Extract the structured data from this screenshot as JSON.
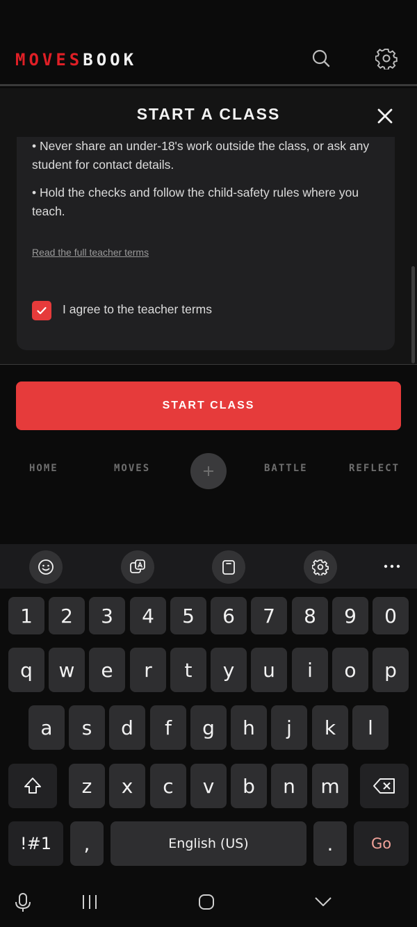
{
  "app": {
    "logo_red": "MOVES",
    "logo_white": "BOOK",
    "header_icons": [
      "search-icon",
      "gear-icon"
    ]
  },
  "sheet": {
    "title": "START A CLASS",
    "close_icon": "close-icon",
    "bullets": [
      "• Never share an under-18's work outside the class, or ask any student for contact details.",
      "• Hold the checks and follow the child-safety rules where you teach."
    ],
    "terms_link": "Read the full teacher terms",
    "agree_label": "I agree to the teacher terms",
    "agree_checked": true
  },
  "cta": {
    "label": "START CLASS"
  },
  "bottom_nav": {
    "items": [
      {
        "label": "HOME"
      },
      {
        "label": "MOVES"
      },
      {
        "label": "BATTLE"
      },
      {
        "label": "REFLECT"
      }
    ],
    "center_icon": "plus-icon"
  },
  "keyboard": {
    "toolbar_icons": [
      "emoji-icon",
      "translate-icon",
      "clipboard-icon",
      "gear-icon",
      "more-icon"
    ],
    "number_row": [
      "1",
      "2",
      "3",
      "4",
      "5",
      "6",
      "7",
      "8",
      "9",
      "0"
    ],
    "row1": [
      "q",
      "w",
      "e",
      "r",
      "t",
      "y",
      "u",
      "i",
      "o",
      "p"
    ],
    "row2": [
      "a",
      "s",
      "d",
      "f",
      "g",
      "h",
      "j",
      "k",
      "l"
    ],
    "row3": [
      "z",
      "x",
      "c",
      "v",
      "b",
      "n",
      "m"
    ],
    "symbols_label": "!#1",
    "comma": ",",
    "space_label": "English (US)",
    "period": ".",
    "go_label": "Go"
  },
  "system_nav": {
    "icons": [
      "mic-icon",
      "recents-icon",
      "home-icon",
      "hide-keyboard-icon"
    ]
  },
  "colors": {
    "accent": "#e63b3b",
    "logo_red": "#e01f26",
    "background": "#0b0b0b"
  }
}
